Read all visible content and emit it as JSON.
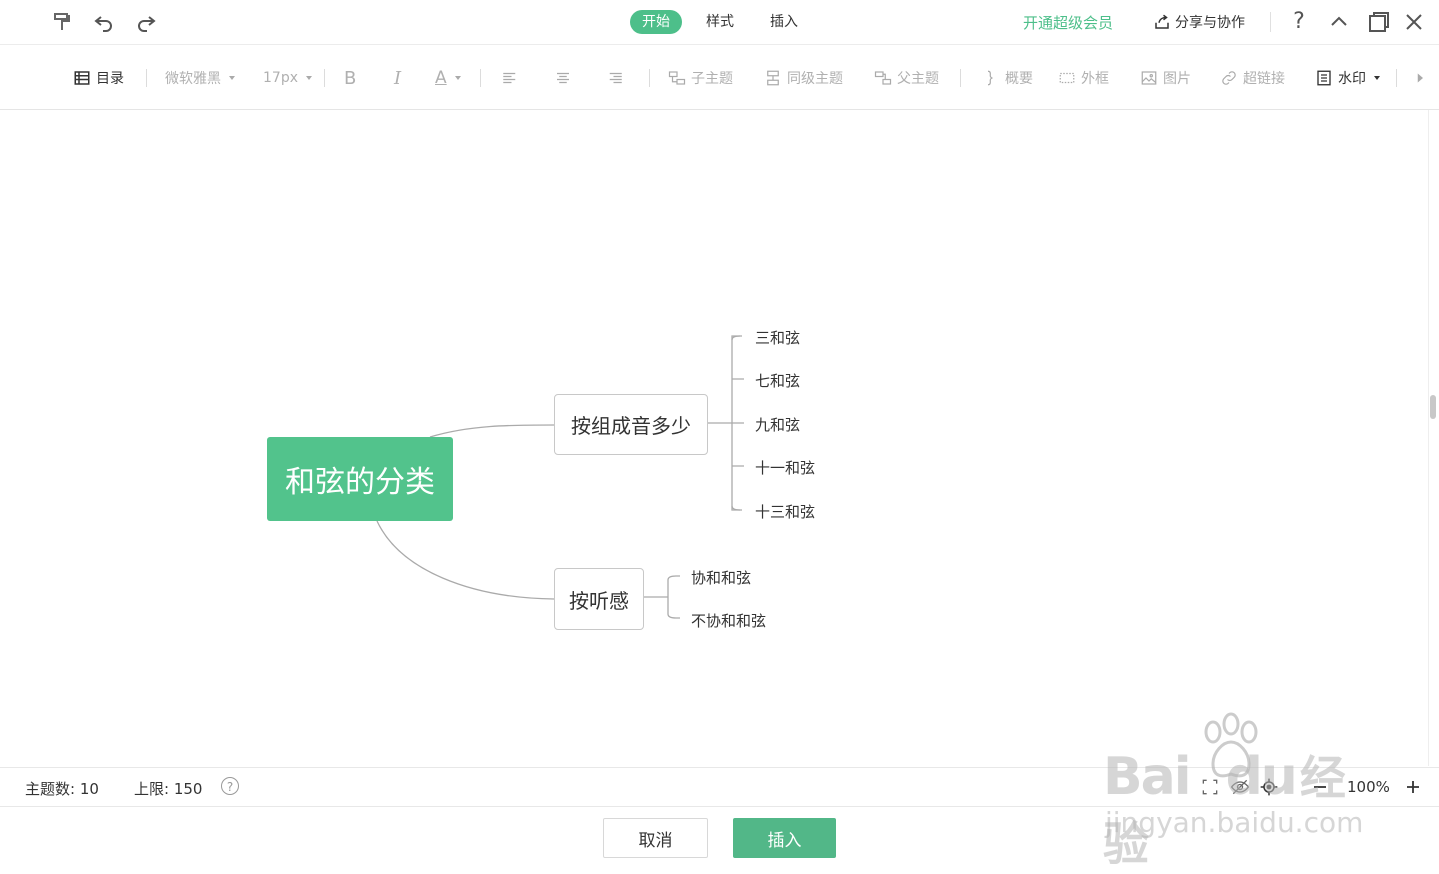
{
  "tabs": [
    {
      "label": "开始",
      "active": true
    },
    {
      "label": "样式",
      "active": false
    },
    {
      "label": "插入",
      "active": false
    }
  ],
  "header": {
    "vip_label": "开通超级会员",
    "share_label": "分享与协作",
    "help_label": "?"
  },
  "toolbar": {
    "outline": "目录",
    "font_family": "微软雅黑",
    "font_size": "17px",
    "bold": "B",
    "italic": "I",
    "color": "A",
    "child_topic": "子主题",
    "sibling_topic": "同级主题",
    "parent_topic": "父主题",
    "summary": "概要",
    "frame": "外框",
    "image": "图片",
    "hyperlink": "超链接",
    "watermark": "水印"
  },
  "mindmap": {
    "root": "和弦的分类",
    "branches": [
      {
        "label": "按组成音多少",
        "children": [
          "三和弦",
          "七和弦",
          "九和弦",
          "十一和弦",
          "十三和弦"
        ]
      },
      {
        "label": "按听感",
        "children": [
          "协和和弦",
          "不协和和弦"
        ]
      }
    ]
  },
  "status": {
    "topic_count_label": "主题数:",
    "topic_count": "10",
    "limit_label": "上限:",
    "limit": "150",
    "zoom": "100%"
  },
  "footer": {
    "cancel": "取消",
    "insert": "插入"
  },
  "watermark_text": {
    "brand": "Bai",
    "brand2": "du",
    "cn": "经验",
    "url": "jingyan.baidu.com"
  },
  "colors": {
    "accent": "#4dbf8a",
    "root_fill": "#52c38c",
    "insert_button": "#52b788"
  }
}
